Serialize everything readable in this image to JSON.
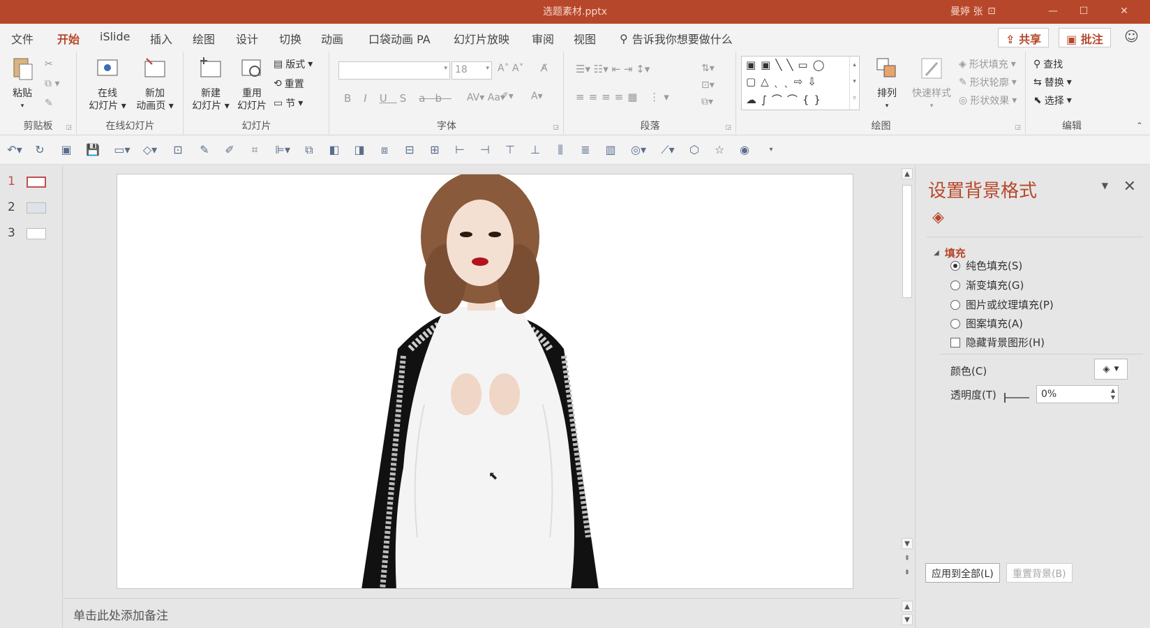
{
  "window": {
    "title": "选题素材.pptx",
    "user": "曼婷 张"
  },
  "menu": {
    "tabs": [
      "文件",
      "开始",
      "iSlide",
      "插入",
      "绘图",
      "设计",
      "切换",
      "动画",
      "口袋动画 PA",
      "幻灯片放映",
      "审阅",
      "视图"
    ],
    "active": "开始",
    "tell_me": "告诉我你想要做什么",
    "share": "共享",
    "comment": "批注"
  },
  "ribbon": {
    "clipboard": {
      "label": "剪贴板",
      "paste": "粘贴"
    },
    "online_slides": {
      "label": "在线幻灯片",
      "online_line1": "在线",
      "online_line2": "幻灯片",
      "new_anim_line1": "新加",
      "new_anim_line2": "动画页"
    },
    "slides": {
      "label": "幻灯片",
      "new_line1": "新建",
      "new_line2": "幻灯片",
      "reuse_line1": "重用",
      "reuse_line2": "幻灯片",
      "layout": "版式",
      "reset": "重置",
      "section": "节"
    },
    "font": {
      "label": "字体",
      "font_name": "",
      "font_size": "18"
    },
    "paragraph": {
      "label": "段落"
    },
    "drawing": {
      "label": "绘图",
      "arrange": "排列",
      "quick_styles": "快速样式",
      "shape_fill": "形状填充",
      "shape_outline": "形状轮廓",
      "shape_effects": "形状效果"
    },
    "editing": {
      "label": "编辑",
      "find": "查找",
      "replace": "替换",
      "select": "选择"
    }
  },
  "thumbnails": [
    {
      "num": "1",
      "active": true
    },
    {
      "num": "2",
      "active": false
    },
    {
      "num": "3",
      "active": false
    }
  ],
  "notes_placeholder": "单击此处添加备注",
  "format_pane": {
    "title": "设置背景格式",
    "section": "填充",
    "options": [
      {
        "label": "纯色填充(S)",
        "type": "radio",
        "checked": true
      },
      {
        "label": "渐变填充(G)",
        "type": "radio",
        "checked": false
      },
      {
        "label": "图片或纹理填充(P)",
        "type": "radio",
        "checked": false
      },
      {
        "label": "图案填充(A)",
        "type": "radio",
        "checked": false
      },
      {
        "label": "隐藏背景图形(H)",
        "type": "checkbox",
        "checked": false
      }
    ],
    "color_label": "颜色(C)",
    "transparency_label": "透明度(T)",
    "transparency_value": "0%",
    "apply_all": "应用到全部(L)",
    "reset_background": "重置背景(B)"
  },
  "colors": {
    "accent": "#b7472a",
    "pane_bg": "#e6e6e6",
    "ribbon_bg": "#f3f3f3"
  }
}
